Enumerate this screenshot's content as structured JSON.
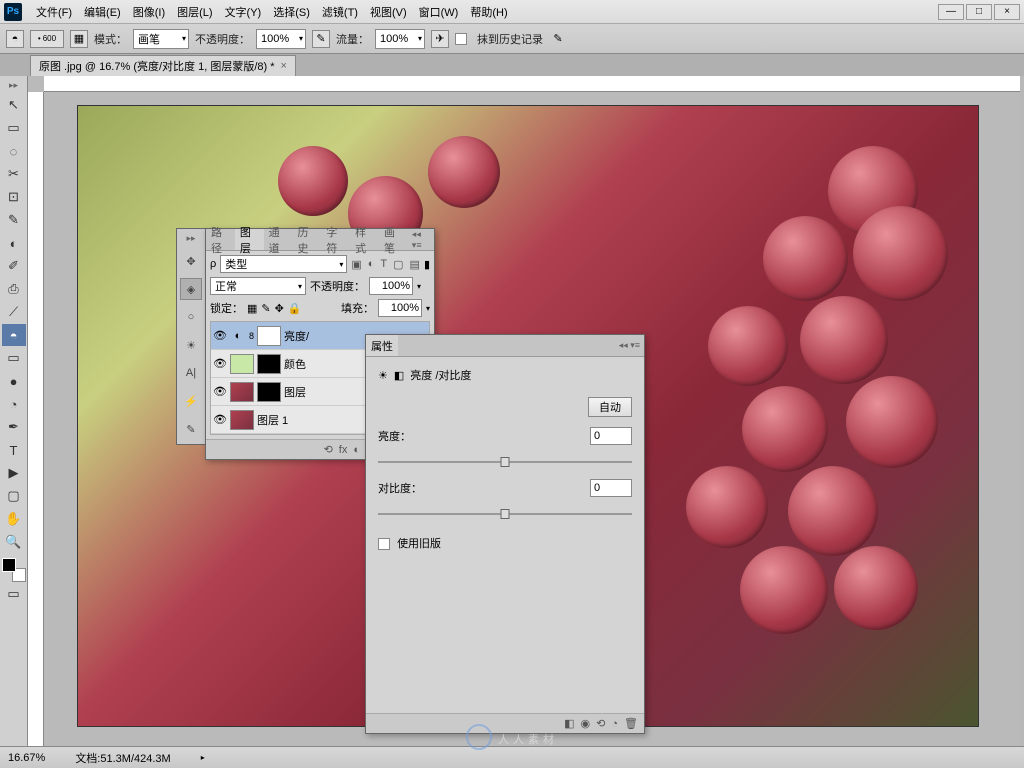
{
  "menubar": [
    "文件(F)",
    "编辑(E)",
    "图像(I)",
    "图层(L)",
    "文字(Y)",
    "选择(S)",
    "滤镜(T)",
    "视图(V)",
    "窗口(W)",
    "帮助(H)"
  ],
  "window_controls": {
    "min": "—",
    "max": "□",
    "close": "×"
  },
  "optbar": {
    "size_value": "600",
    "mode_label": "模式：",
    "mode_value": "画笔",
    "opacity_label": "不透明度：",
    "opacity_value": "100%",
    "flow_label": "流量：",
    "flow_value": "100%",
    "history_label": "抹到历史记录"
  },
  "doc_tab": {
    "title": "原图 .jpg @ 16.7% (亮度/对比度 1, 图层蒙版/8) *",
    "close": "×"
  },
  "tools": [
    "↖",
    "▭",
    "◌",
    "✂",
    "✎",
    "⊡",
    "◐",
    "✐",
    "⟋",
    "⎙",
    "▭",
    "◓",
    "⌒",
    "◔",
    "●",
    "✒",
    "T",
    "▶",
    "▢",
    "✋",
    "🔍"
  ],
  "tool_selected_index": 11,
  "layers_panel": {
    "tabs": [
      "路径",
      "图层",
      "通道",
      "历史",
      "字符",
      "样式",
      "画笔"
    ],
    "active_tab": 1,
    "kind_label": "类型",
    "blend_mode": "正常",
    "opacity_label": "不透明度：",
    "opacity_value": "100%",
    "lock_label": "锁定：",
    "fill_label": "填充：",
    "fill_value": "100%",
    "layers": [
      {
        "name": "亮度/",
        "active": true,
        "adj": true
      },
      {
        "name": "颜色",
        "active": false,
        "green": true
      },
      {
        "name": "图层",
        "active": false,
        "img": true
      },
      {
        "name": "图层 1",
        "active": false,
        "img": true
      }
    ],
    "footer_icons": [
      "⟲",
      "fx",
      "◐",
      "◧",
      "▣",
      "⊞",
      "🗑"
    ]
  },
  "props_panel": {
    "title": "属性",
    "subtitle": "亮度 /对比度",
    "auto_btn": "自动",
    "brightness_label": "亮度：",
    "brightness_value": "0",
    "contrast_label": "对比度：",
    "contrast_value": "0",
    "legacy_label": "使用旧版",
    "footer_icons": [
      "◧",
      "◉",
      "⟲",
      "◔",
      "🗑"
    ]
  },
  "strip_icons": [
    "✥",
    "◈",
    "○",
    "☀",
    "A|",
    "⚡",
    "✎"
  ],
  "status": {
    "zoom": "16.67%",
    "doc": "文档:51.3M/424.3M"
  },
  "watermark": "人人素材"
}
